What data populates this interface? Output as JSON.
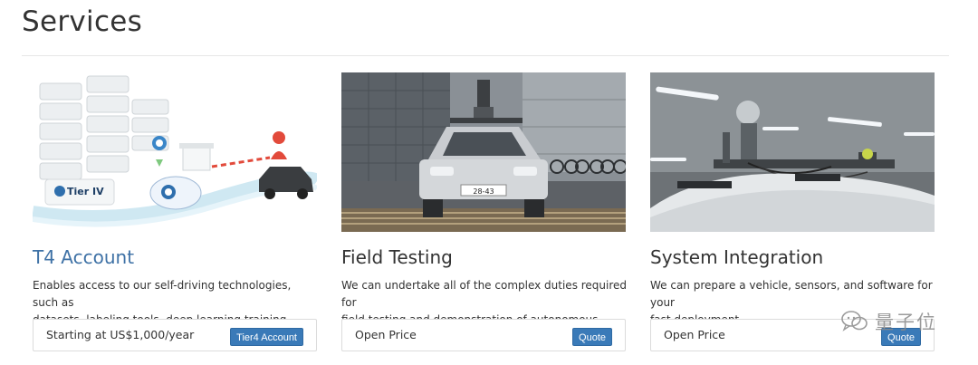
{
  "page": {
    "title": "Services"
  },
  "cards": [
    {
      "title": "T4 Account",
      "description_line1": "Enables access to our self-driving technologies, such as",
      "description_line2": "datasets, labeling tools, deep learning training services.",
      "price": "Starting at US$1,000/year",
      "button": "Tier4 Account",
      "image_text": "Tier IV"
    },
    {
      "title": "Field Testing",
      "description_line1": "We can undertake all of the complex duties required for",
      "description_line2": "field testing and demonstration of autonomous driving.",
      "price": "Open Price",
      "button": "Quote",
      "image_plate": "28-43"
    },
    {
      "title": "System Integration",
      "description_line1": "We can prepare a vehicle, sensors, and software for your",
      "description_line2": "fast deployment.",
      "price": "Open Price",
      "button": "Quote"
    }
  ],
  "watermark": {
    "text": "量子位"
  },
  "colors": {
    "link": "#3f72a6",
    "button": "#3a7ab8",
    "border": "#dcdcdc"
  }
}
